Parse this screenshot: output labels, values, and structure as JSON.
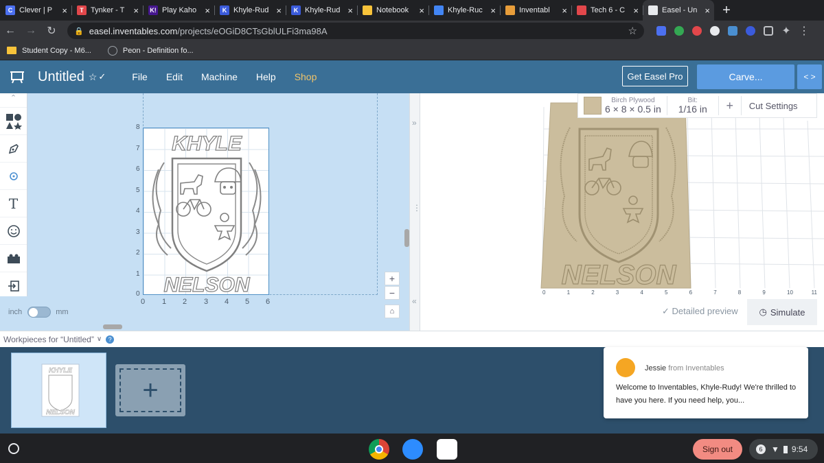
{
  "browser": {
    "tabs": [
      {
        "label": "Clever | P",
        "icon": "C",
        "color": "#4c70f0"
      },
      {
        "label": "Tynker - T",
        "icon": "T",
        "color": "#e2474b"
      },
      {
        "label": "Play Kaho",
        "icon": "K!",
        "color": "#46178f"
      },
      {
        "label": "Khyle-Rud",
        "icon": "K",
        "color": "#3b5bdb"
      },
      {
        "label": "Khyle-Rud",
        "icon": "K",
        "color": "#3b5bdb"
      },
      {
        "label": "Notebook",
        "icon": "",
        "color": "#f8c33a"
      },
      {
        "label": "Khyle-Ruc",
        "icon": "",
        "color": "#4285f4"
      },
      {
        "label": "Inventabl",
        "icon": "",
        "color": "#e89d3a"
      },
      {
        "label": "Tech 6 - C",
        "icon": "",
        "color": "#e2474b"
      },
      {
        "label": "Easel - Un",
        "icon": "",
        "color": "#e8eaed"
      }
    ],
    "url_host": "easel.inventables.com",
    "url_path": "/projects/eOGiD8CTsGblULFi3ma98A",
    "bookmarks": [
      "Student Copy - M6...",
      "Peon - Definition fo..."
    ]
  },
  "easel": {
    "project_name": "Untitled",
    "menu": [
      "File",
      "Edit",
      "Machine",
      "Help",
      "Shop"
    ],
    "get_pro": "Get Easel Pro",
    "carve": "Carve...",
    "units": {
      "left": "inch",
      "right": "mm"
    },
    "y_ticks": [
      "8",
      "7",
      "6",
      "5",
      "4",
      "3",
      "2",
      "1",
      "0"
    ],
    "x_ticks": [
      "0",
      "1",
      "2",
      "3",
      "4",
      "5",
      "6"
    ],
    "design_top_text": "KHYLE",
    "design_bottom_text": "NELSON",
    "material": {
      "name": "Birch Plywood",
      "dims": "6 × 8 × 0.5 in"
    },
    "bit": {
      "label": "Bit:",
      "value": "1/16 in"
    },
    "add": "+",
    "cut_settings": "Cut Settings",
    "preview_x_ticks": [
      "0",
      "1",
      "2",
      "3",
      "4",
      "5",
      "6",
      "7",
      "8",
      "9",
      "10",
      "11"
    ],
    "detailed_preview": "Detailed preview",
    "simulate": "Simulate",
    "workpieces_label": "Workpieces for “Untitled”"
  },
  "chat": {
    "sender": "Jessie",
    "from_suffix": "from Inventables",
    "message": "Welcome to Inventables, Khyle-Rudy! We're thrilled to have you here. If you need help, you..."
  },
  "shelf": {
    "sign_out": "Sign out",
    "notif_count": "6",
    "time": "9:54"
  }
}
